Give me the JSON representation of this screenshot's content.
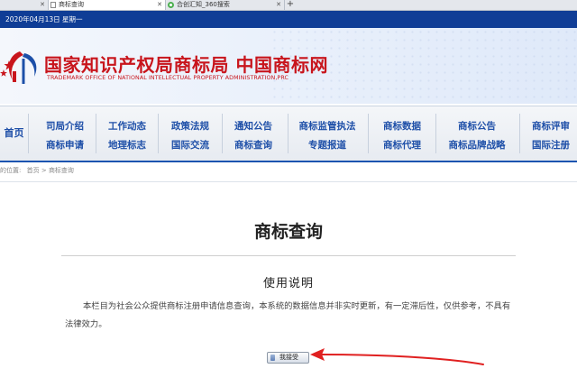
{
  "browser": {
    "tabs": [
      {
        "label": "",
        "active": false
      },
      {
        "label": "商标查询",
        "active": true
      },
      {
        "label": "合创汇知_360搜索",
        "active": false
      }
    ],
    "new_tab_label": "+"
  },
  "datebar": {
    "text": "2020年04月13日 星期一"
  },
  "header": {
    "title": "国家知识产权局商标局 中国商标网",
    "subtitle": "TRADEMARK OFFICE OF NATIONAL INTELLECTUAL PROPERTY ADMINISTRATION,PRC",
    "brand_color": "#c8151c"
  },
  "nav": {
    "home": "首页",
    "items": [
      "司局介绍",
      "商标申请",
      "工作动态",
      "地理标志",
      "政策法规",
      "国际交流",
      "通知公告",
      "商标查询",
      "商标监管执法",
      "专题报道",
      "商标数据",
      "商标代理",
      "商标公告",
      "商标品牌战略",
      "商标评审",
      "国际注册"
    ]
  },
  "breadcrumb": {
    "prefix": "的位置:",
    "home": "首页",
    "separator": ">",
    "current": "商标查询"
  },
  "main": {
    "title": "商标查询",
    "notice_title": "使用说明",
    "notice_body": "本栏目为社会公众提供商标注册申请信息查询，本系统的数据信息并非实时更新，有一定滞后性，仅供参考，不具有法律效力。",
    "accept_button": "我接受"
  },
  "annotation_arrow_color": "#e02020"
}
